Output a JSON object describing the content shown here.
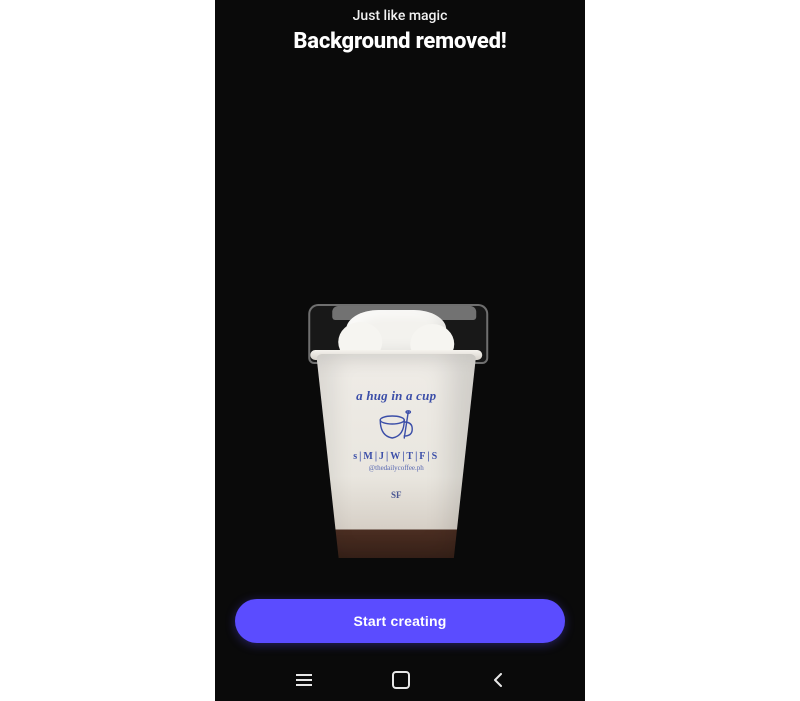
{
  "header": {
    "subtitle": "Just like magic",
    "title": "Background removed!"
  },
  "cup_print": {
    "slogan": "a hug in a cup",
    "days": "s|M|J|W|T|F|S",
    "handle": "@thedailycoffee.ph",
    "bottom_text": "SF"
  },
  "cta": {
    "label": "Start creating"
  },
  "navbar": {
    "recent": "recent-apps",
    "home": "home",
    "back": "back"
  },
  "colors": {
    "accent": "#5b4cff",
    "cup_ink": "#3b4ea8"
  }
}
